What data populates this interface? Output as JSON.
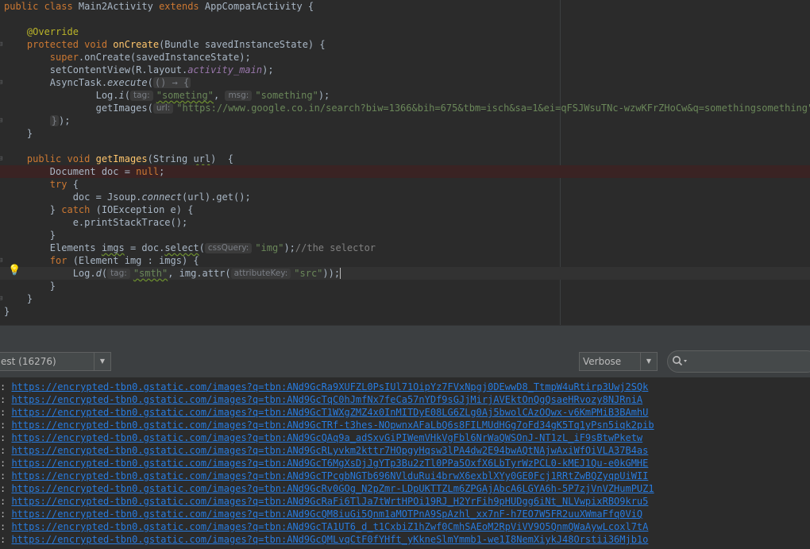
{
  "editor": {
    "lines": [
      [
        {
          "c": "kw",
          "t": "public class "
        },
        {
          "t": "Main2Activity "
        },
        {
          "c": "kw",
          "t": "extends "
        },
        {
          "t": "AppCompatActivity {"
        }
      ],
      [],
      [
        {
          "t": "    "
        },
        {
          "c": "ann",
          "t": "@Override"
        }
      ],
      [
        {
          "t": "    "
        },
        {
          "c": "kw",
          "t": "protected void "
        },
        {
          "c": "fn",
          "t": "onCreate"
        },
        {
          "t": "(Bundle savedInstanceState) {"
        }
      ],
      [
        {
          "t": "        "
        },
        {
          "c": "kw",
          "t": "super"
        },
        {
          "t": "."
        },
        {
          "t": "onCreate(savedInstanceState);"
        }
      ],
      [
        {
          "t": "        setContentView(R.layout."
        },
        {
          "c": "fld",
          "t": "activity_main"
        },
        {
          "t": ");"
        }
      ],
      [
        {
          "t": "        AsyncTask."
        },
        {
          "c": "it",
          "t": "execute"
        },
        {
          "t": "("
        },
        {
          "c": "lam",
          "t": "() → {"
        }
      ],
      [
        {
          "t": "                Log."
        },
        {
          "c": "it",
          "t": "i"
        },
        {
          "t": "("
        },
        {
          "c": "hint",
          "t": "tag:"
        },
        {
          "c": "str squig",
          "t": "\"someting\""
        },
        {
          "t": ", "
        },
        {
          "c": "hint",
          "t": "msg:"
        },
        {
          "c": "str",
          "t": "\"something\""
        },
        {
          "t": ");"
        }
      ],
      [
        {
          "t": "                getImages("
        },
        {
          "c": "hint",
          "t": "url:"
        },
        {
          "c": "str",
          "t": "\"https://www.google.co.in/search?biw=1366&bih=675&tbm=isch&sa=1&ei=qFSJWsuTNc-wzwKFrZHoCw&q=somethingsomething\""
        },
        {
          "t": ");"
        }
      ],
      [
        {
          "t": "        "
        },
        {
          "c": "lam",
          "t": "}"
        },
        {
          "t": ");"
        }
      ],
      [
        {
          "t": "    }"
        }
      ],
      [],
      [
        {
          "t": "    "
        },
        {
          "c": "kw",
          "t": "public void "
        },
        {
          "c": "fn",
          "t": "getImages"
        },
        {
          "t": "(String "
        },
        {
          "c": "squig",
          "t": "url"
        },
        {
          "t": ")  {"
        }
      ],
      [
        {
          "t": "        Document doc = "
        },
        {
          "c": "kw",
          "t": "null"
        },
        {
          "t": ";"
        }
      ],
      [
        {
          "t": "        "
        },
        {
          "c": "kw",
          "t": "try "
        },
        {
          "t": "{"
        }
      ],
      [
        {
          "t": "            doc = Jsoup."
        },
        {
          "c": "it",
          "t": "connect"
        },
        {
          "t": "(url).get();"
        }
      ],
      [
        {
          "t": "        } "
        },
        {
          "c": "kw",
          "t": "catch "
        },
        {
          "t": "(IOException e) {"
        }
      ],
      [
        {
          "t": "            e.printStackTrace();"
        }
      ],
      [
        {
          "t": "        }"
        }
      ],
      [
        {
          "t": "        Elements "
        },
        {
          "c": "squig",
          "t": "imgs"
        },
        {
          "t": " = doc."
        },
        {
          "c": "squig",
          "t": "select"
        },
        {
          "t": "("
        },
        {
          "c": "hint",
          "t": "cssQuery:"
        },
        {
          "c": "str",
          "t": "\"img\""
        },
        {
          "t": ");"
        },
        {
          "c": "cmt",
          "t": "//the selector"
        }
      ],
      [
        {
          "t": "        "
        },
        {
          "c": "kw",
          "t": "for "
        },
        {
          "t": "(Element img : imgs) {"
        }
      ],
      [
        {
          "t": "            Log."
        },
        {
          "c": "it",
          "t": "d"
        },
        {
          "t": "("
        },
        {
          "c": "hint",
          "t": "tag:"
        },
        {
          "c": "str squig",
          "t": "\"smth\""
        },
        {
          "t": ", img.attr("
        },
        {
          "c": "hint",
          "t": "attributeKey:"
        },
        {
          "c": "str",
          "t": "\"src\""
        },
        {
          "t": "));"
        }
      ],
      [
        {
          "t": "        }"
        }
      ],
      [
        {
          "t": "    }"
        }
      ],
      [
        {
          "t": "}"
        }
      ]
    ],
    "warn_line": 13,
    "cursor_line": 21
  },
  "logcat": {
    "process_filter": "est (16276)",
    "level": "Verbose",
    "search_icon": "search-icon",
    "lines": [
      "https://encrypted-tbn0.gstatic.com/images?q=tbn:ANd9GcRa9XUFZL0PsIUl71OipYz7FVxNpgj0DEwwD8_TtmpW4uRtirp3Uwj2SQk",
      "https://encrypted-tbn0.gstatic.com/images?q=tbn:ANd9GcTqC0hJmfNx7feCa57nYDf9sGJjMirjAVEktOnQgQsaeHRvozy8NJRniA",
      "https://encrypted-tbn0.gstatic.com/images?q=tbn:ANd9GcT1WXgZMZ4x0InMITDyE08LG6ZLg0Aj5bwolCAzOQwx-v6KmPMiB3BAmhU",
      "https://encrypted-tbn0.gstatic.com/images?q=tbn:ANd9GcTRf-t3hes-NOpwnxAFaLbQ6s8FILMUdHGg7oFd34gK5Tq1yPsn5iqk2pib",
      "https://encrypted-tbn0.gstatic.com/images?q=tbn:ANd9GcQAq9a_adSxvGiPIWemVHkVgFbl6NrWaQWSOnJ-NT1zL_iF9sBtwPketw",
      "https://encrypted-tbn0.gstatic.com/images?q=tbn:ANd9GcRLyvkm2kttr7HOpgyHqsw3lPA4dw2E94bwAQtNAjwAxiWfOiVLA37B4as",
      "https://encrypted-tbn0.gstatic.com/images?q=tbn:ANd9GcT6MgXsDjJgYTp3Bu2zTl0PPa5OxfX6LbTyrWzPCL0-kMEJ1Qu-e0kGMHE",
      "https://encrypted-tbn0.gstatic.com/images?q=tbn:ANd9GcTPcgbNGTb696NVlduRui4brwX6exblXYy0GE0Fcj1RRtZwBQZyqpUiWII",
      "https://encrypted-tbn0.gstatic.com/images?q=tbn:ANd9GcRv0GOg_N2pZmr-LDpUKTTZLm6ZPGAjAbcA6LGYA6h-5P7zjVnVZHumPUZ1",
      "https://encrypted-tbn0.gstatic.com/images?q=tbn:ANd9GcRaFi6TlJa7tWrtHPOi19RJ_H2YrFih9pHUDgg6iNt_NLVwpixRBO9kru5",
      "https://encrypted-tbn0.gstatic.com/images?q=tbn:ANd9GcQM8iuGi5Qnm1aMOTPnA9SpAzhl_xx7nF-h7EO7W5FR2uuXWmaFfq0ViQ",
      "https://encrypted-tbn0.gstatic.com/images?q=tbn:ANd9GcTA1UT6_d_t1CxbiZ1hZwf0CmhSAEoM2RpViVV9O5QnmQWaAywLcoxl7tA",
      "https://encrypted-tbn0.gstatic.com/images?q=tbn:ANd9GcQMLvqCtF0fYHft_yKkneSlmYmmb1-we1I8NemXiykJ48Orstii36Mjb1o"
    ]
  }
}
